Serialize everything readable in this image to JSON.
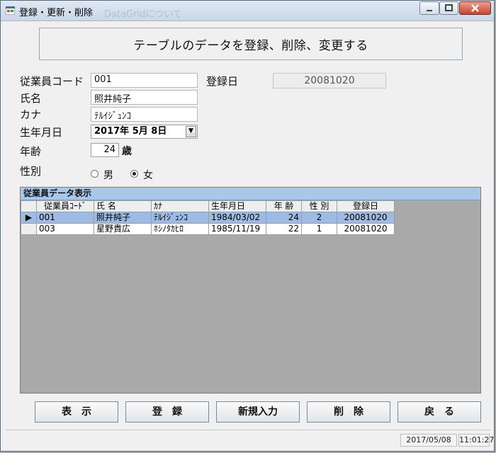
{
  "window": {
    "title": "登録・更新・削除",
    "ghost_title": "DataGridについて"
  },
  "header": {
    "text": "テーブルのデータを登録、削除、変更する"
  },
  "form": {
    "employee_code_label": "従業員コード",
    "employee_code_value": "001",
    "registration_date_label": "登録日",
    "registration_date_value": "20081020",
    "name_label": "氏名",
    "name_value": "照井純子",
    "kana_label": "カナ",
    "kana_value": "ﾃﾙｲｼﾞｭﾝｺ",
    "birthdate_label": "生年月日",
    "birthdate_value": "2017年 5月 8日",
    "age_label": "年齢",
    "age_value": "24",
    "age_unit": "歳",
    "gender_label": "性別",
    "gender_male": "男",
    "gender_female": "女",
    "gender_selected": "女"
  },
  "grid": {
    "caption": "従業員データ表示",
    "headers": [
      "従業員ｺｰﾄﾞ",
      "氏 名",
      "ｶﾅ",
      "生年月日",
      "年 齢",
      "性 別",
      "登録日"
    ],
    "rows": [
      [
        "001",
        "照井純子",
        "ﾃﾙｲｼﾞｭﾝｺ",
        "1984/03/02",
        "24",
        "2",
        "20081020"
      ],
      [
        "003",
        "星野貴広",
        "ﾎｼﾉﾀｶﾋﾛ",
        "1985/11/19",
        "22",
        "1",
        "20081020"
      ]
    ],
    "selected_row": 0,
    "row_indicator": "▶"
  },
  "buttons": {
    "display": "表　示",
    "register": "登　録",
    "new_entry": "新規入力",
    "delete": "削　除",
    "back": "戻　る"
  },
  "status": {
    "date": "2017/05/08",
    "time": "11:01:27"
  },
  "icons": {
    "app": "app-form-icon",
    "dropdown": "chevron-down-icon"
  }
}
